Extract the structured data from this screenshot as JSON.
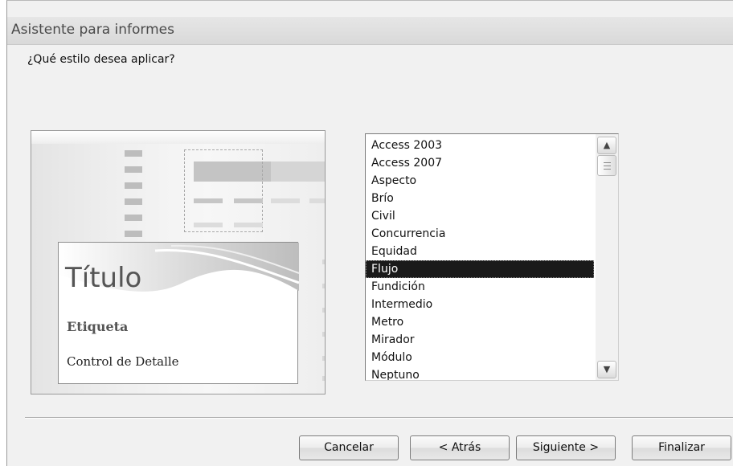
{
  "window": {
    "title": "Asistente para informes"
  },
  "prompt": "¿Qué estilo desea aplicar?",
  "preview": {
    "title": "Título",
    "label": "Etiqueta",
    "detail": "Control de Detalle"
  },
  "style_list": {
    "items": [
      "Access 2003",
      "Access 2007",
      "Aspecto",
      "Brío",
      "Civil",
      "Concurrencia",
      "Equidad",
      "Flujo",
      "Fundición",
      "Intermedio",
      "Metro",
      "Mirador",
      "Módulo",
      "Neptuno"
    ],
    "selected": "Flujo"
  },
  "buttons": {
    "cancel": "Cancelar",
    "back": "< Atrás",
    "next": "Siguiente >",
    "finish": "Finalizar"
  },
  "icons": {
    "scroll_up": "scroll-up-arrow-icon",
    "scroll_down": "scroll-down-arrow-icon"
  },
  "colors": {
    "selection": "#1a1a1a",
    "dialog_bg": "#f1f1f1"
  }
}
